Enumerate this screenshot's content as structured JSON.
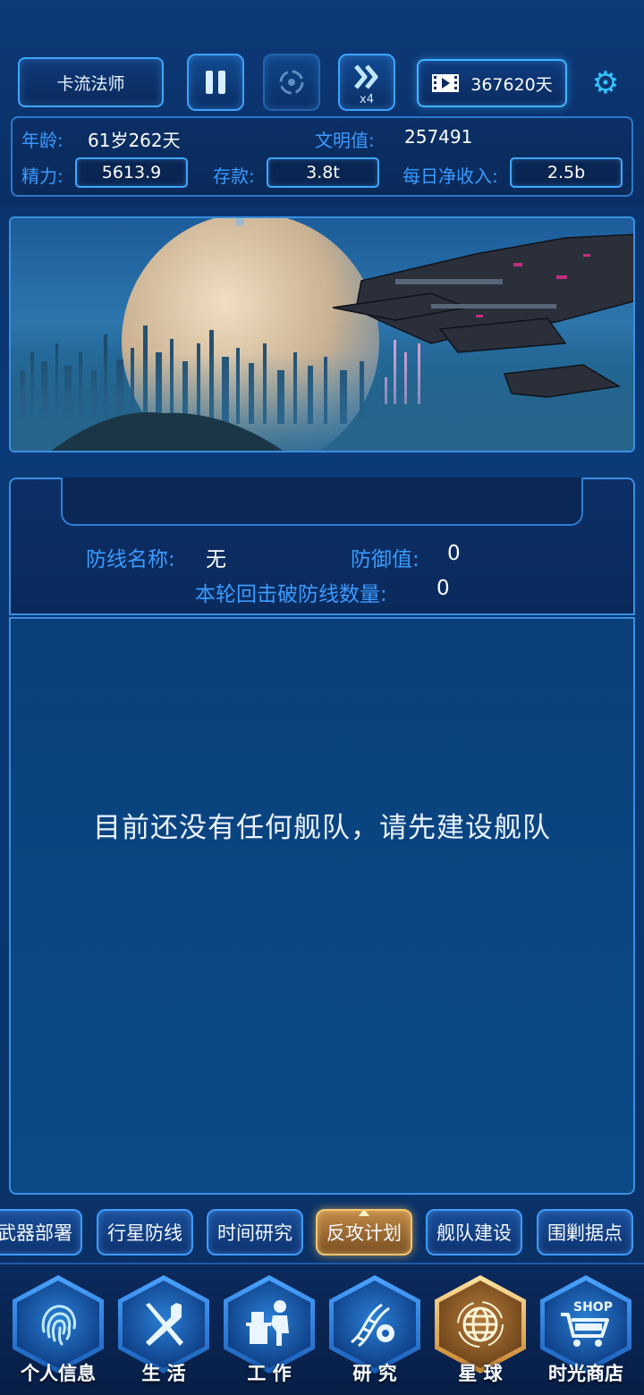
{
  "header": {
    "player_name": "卡流法师",
    "speed_label": "x4",
    "days_value": "367620天",
    "icons": {
      "pause": "pause-icon",
      "target": "target-icon",
      "fast_forward": "fast-forward-icon",
      "video": "video-icon",
      "settings": "gear-icon"
    }
  },
  "stats": {
    "age_label": "年龄:",
    "age_value": "61岁262天",
    "civ_label": "文明值:",
    "civ_value": "257491",
    "energy_label": "精力:",
    "energy_value": "5613.9",
    "savings_label": "存款:",
    "savings_value": "3.8t",
    "income_label": "每日净收入:",
    "income_value": "2.5b"
  },
  "defense": {
    "name_label": "防线名称:",
    "name_value": "无",
    "defense_label": "防御值:",
    "defense_value": "0",
    "broken_label": "本轮回击破防线数量:",
    "broken_value": "0"
  },
  "fleet": {
    "empty_message": "目前还没有任何舰队，请先建设舰队"
  },
  "subtabs": [
    {
      "label": "武器部署"
    },
    {
      "label": "行星防线"
    },
    {
      "label": "时间研究"
    },
    {
      "label": "反攻计划",
      "active": true
    },
    {
      "label": "舰队建设"
    },
    {
      "label": "围剿据点"
    }
  ],
  "nav": [
    {
      "label": "个人信息",
      "icon": "fingerprint-icon"
    },
    {
      "label": "生 活",
      "icon": "fork-knife-icon"
    },
    {
      "label": "工 作",
      "icon": "desk-worker-icon"
    },
    {
      "label": "研 究",
      "icon": "dna-gear-icon"
    },
    {
      "label": "星 球",
      "icon": "globe-icon",
      "active": true
    },
    {
      "label": "时光商店",
      "icon": "shop-cart-icon",
      "badge": "SHOP"
    }
  ],
  "colors": {
    "accent": "#3a9bff",
    "active_gold": "#f6c66b",
    "panel": "#0b2f66"
  }
}
